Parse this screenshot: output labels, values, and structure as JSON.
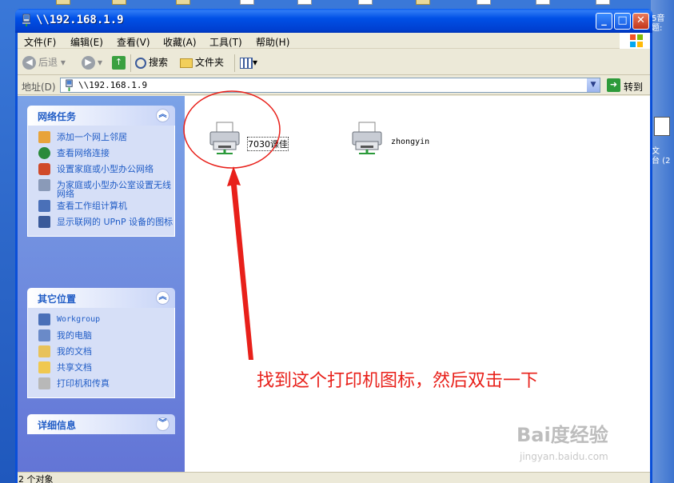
{
  "window": {
    "title": "\\\\192.168.1.9",
    "buttons": {
      "minimize": "_",
      "maximize": "□",
      "close": "✕"
    }
  },
  "menu": [
    "文件(F)",
    "编辑(E)",
    "查看(V)",
    "收藏(A)",
    "工具(T)",
    "帮助(H)"
  ],
  "toolbar": {
    "back": "后退",
    "search": "搜索",
    "folders": "文件夹"
  },
  "address": {
    "label": "地址(D)",
    "value": "\\\\192.168.1.9",
    "go": "转到"
  },
  "network_tasks": {
    "title": "网络任务",
    "items": [
      {
        "label": "添加一个网上邻居",
        "icon": "add-network-place-icon"
      },
      {
        "label": "查看网络连接",
        "icon": "network-connections-icon"
      },
      {
        "label": "设置家庭或小型办公网络",
        "icon": "home-network-icon"
      },
      {
        "label": "为家庭或小型办公室设置无线网络",
        "icon": "wireless-network-icon"
      },
      {
        "label": "查看工作组计算机",
        "icon": "workgroup-computers-icon"
      },
      {
        "label": "显示联网的 UPnP 设备的图标",
        "icon": "upnp-icon"
      }
    ]
  },
  "other_places": {
    "title": "其它位置",
    "items": [
      {
        "label": "Workgroup",
        "icon": "workgroup-icon"
      },
      {
        "label": "我的电脑",
        "icon": "my-computer-icon"
      },
      {
        "label": "我的文档",
        "icon": "my-documents-icon"
      },
      {
        "label": "共享文档",
        "icon": "shared-documents-icon"
      },
      {
        "label": "打印机和传真",
        "icon": "printers-icon"
      }
    ]
  },
  "details": {
    "title": "详细信息"
  },
  "printers": [
    {
      "label": "7030课佳"
    },
    {
      "label": "zhongyin"
    }
  ],
  "status": "2 个对象",
  "annotation": "找到这个打印机图标，然后双击一下",
  "watermark": {
    "main": "Bai度经验",
    "sub": "jingyan.baidu.com"
  },
  "desktop_right": {
    "line1": "5音",
    "line2": "题:",
    "line3": "文",
    "line4": "台 (2"
  },
  "colors": {
    "annotation": "#e8201a",
    "link": "#215dc6",
    "title_bar": "#0050e6"
  }
}
